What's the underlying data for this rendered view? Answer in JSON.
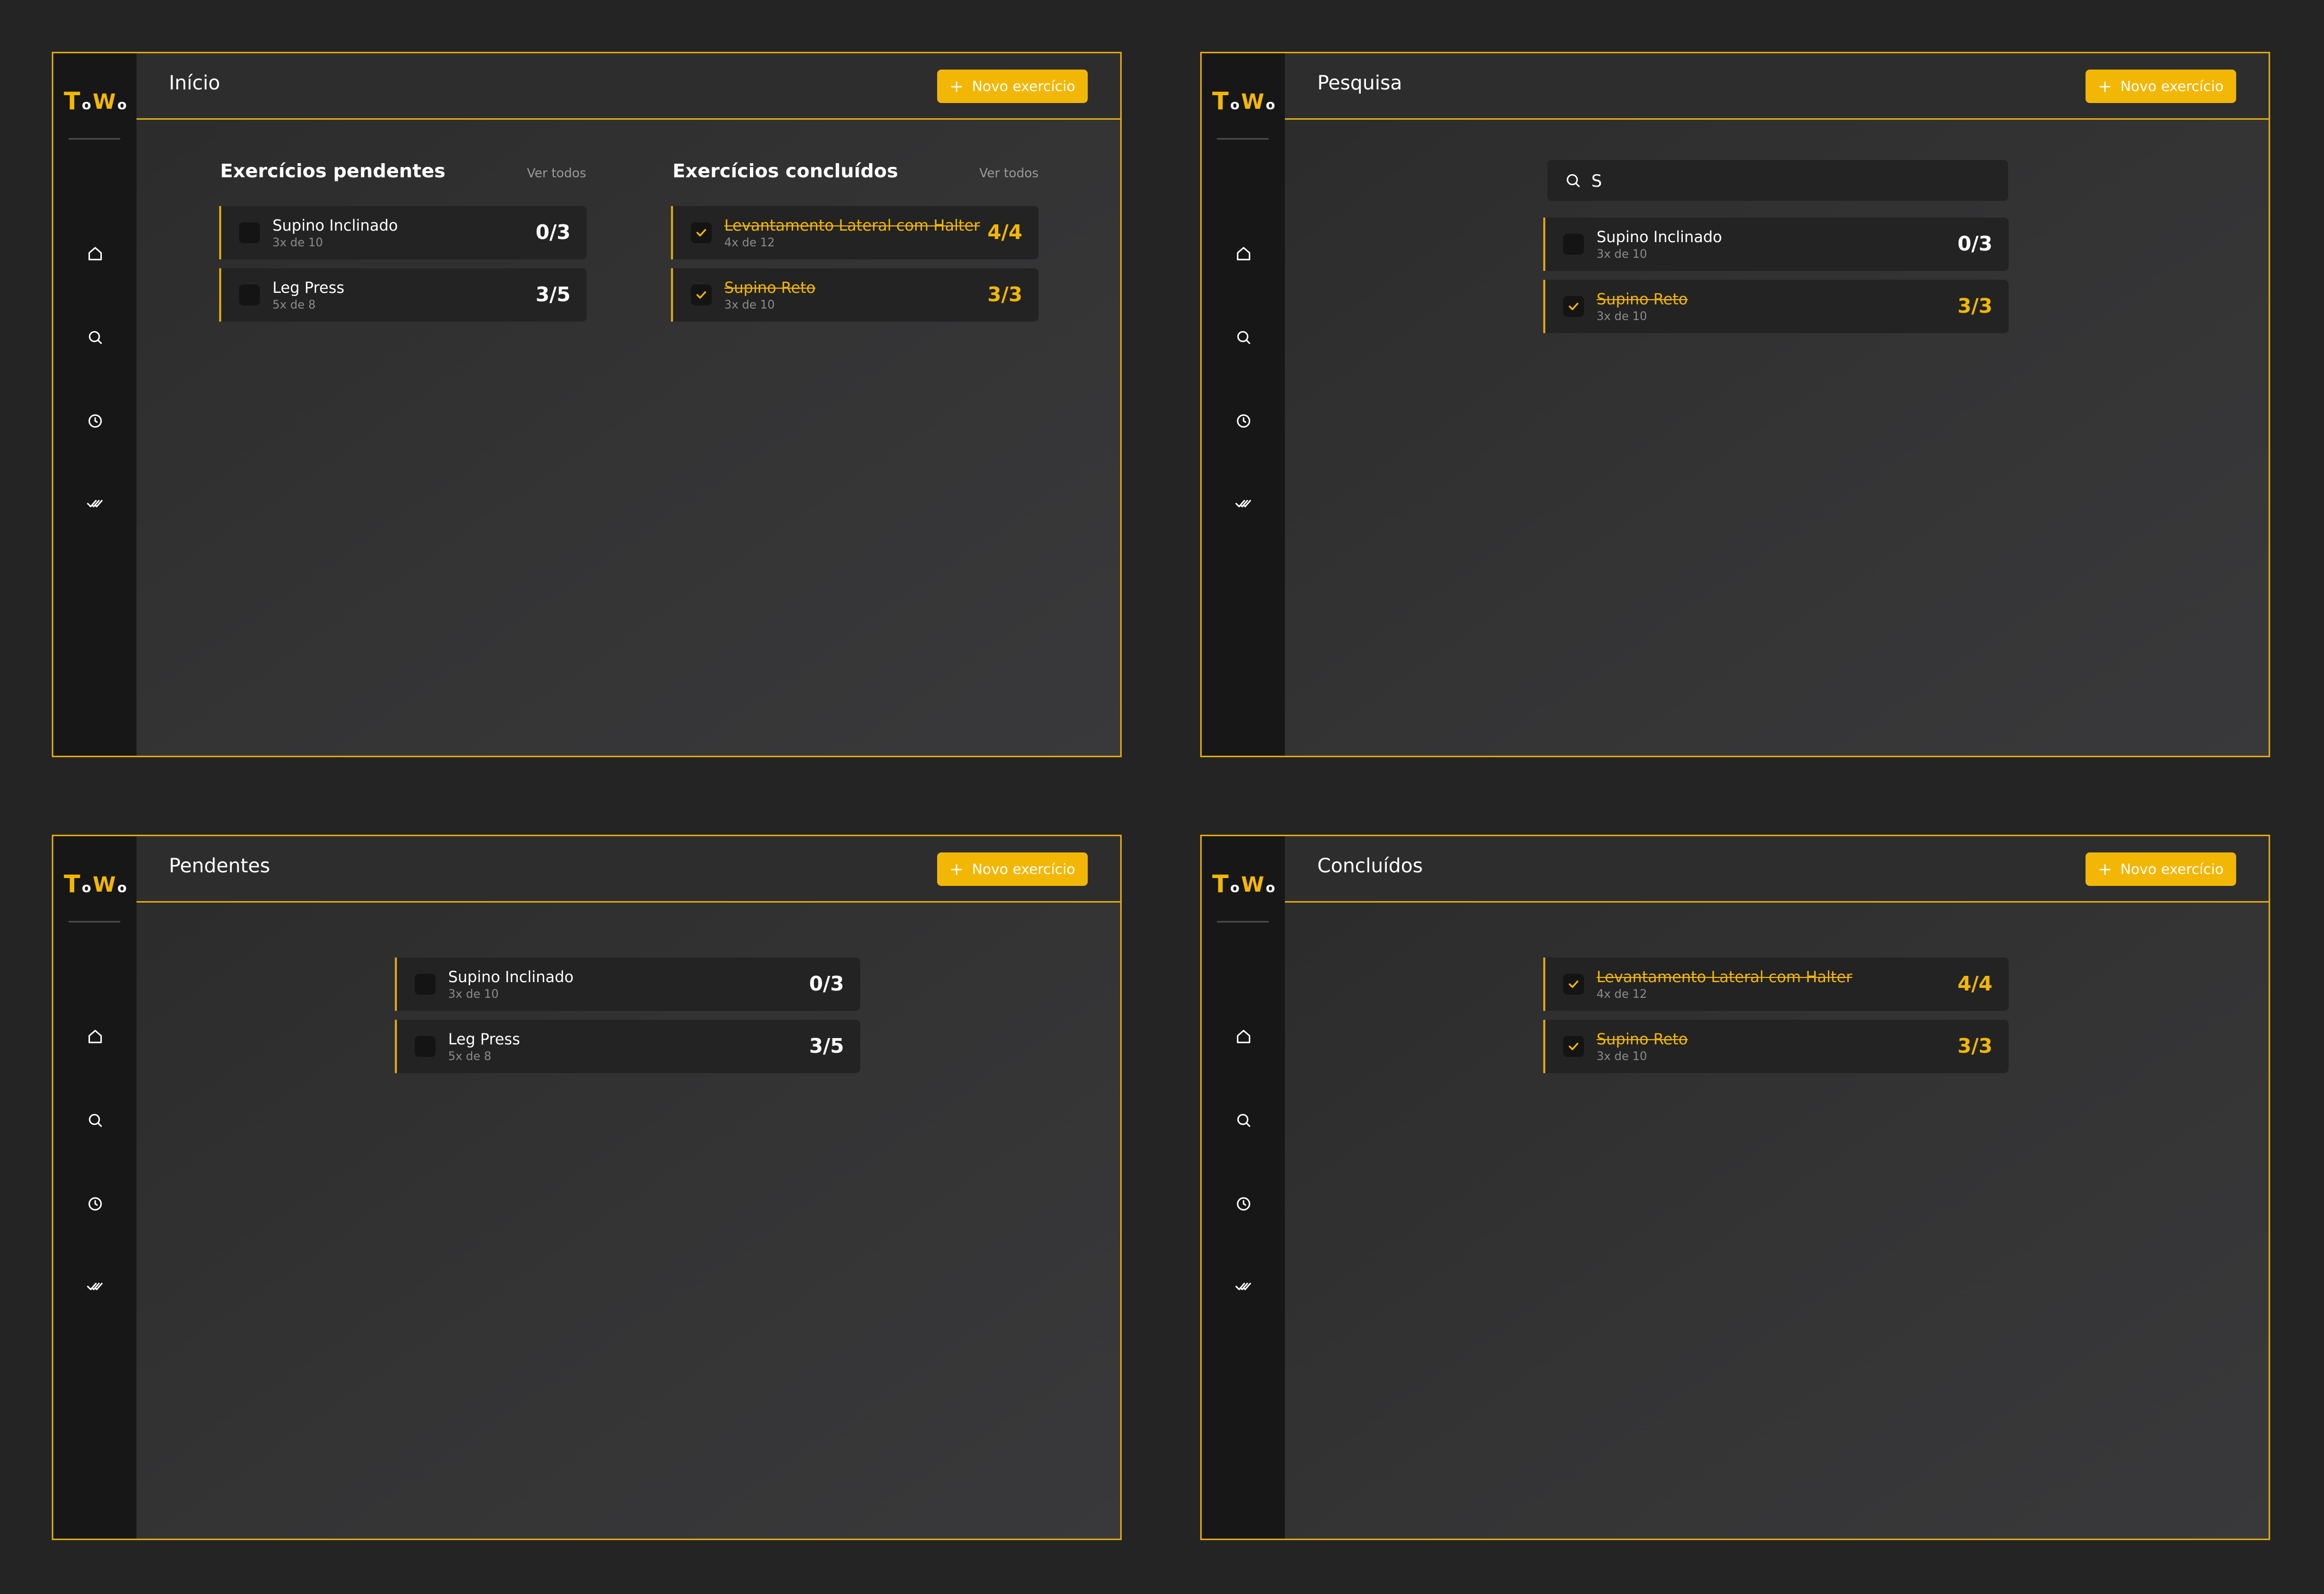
{
  "logo": {
    "t": "T",
    "o1": "o",
    "w": "W",
    "o2": "o"
  },
  "new_button_label": "Novo exercício",
  "new_button_plus": "+",
  "screens": {
    "home": {
      "title": "Início",
      "pending": {
        "title": "Exercícios pendentes",
        "see_all": "Ver todos",
        "items": [
          {
            "name": "Supino Inclinado",
            "sets": "3x de 10",
            "count": "0/3"
          },
          {
            "name": "Leg Press",
            "sets": "5x de 8",
            "count": "3/5"
          }
        ]
      },
      "done": {
        "title": "Exercícios concluídos",
        "see_all": "Ver todos",
        "items": [
          {
            "name": "Levantamento Lateral com Halter",
            "sets": "4x de 12",
            "count": "4/4"
          },
          {
            "name": "Supino Reto",
            "sets": "3x de 10",
            "count": "3/3"
          }
        ]
      }
    },
    "search": {
      "title": "Pesquisa",
      "query": "S",
      "results": [
        {
          "name": "Supino Inclinado",
          "sets": "3x de 10",
          "count": "0/3"
        },
        {
          "name": "Supino Reto",
          "sets": "3x de 10",
          "count": "3/3"
        }
      ]
    },
    "pending": {
      "title": "Pendentes",
      "items": [
        {
          "name": "Supino Inclinado",
          "sets": "3x de 10",
          "count": "0/3"
        },
        {
          "name": "Leg Press",
          "sets": "5x de 8",
          "count": "3/5"
        }
      ]
    },
    "done": {
      "title": "Concluídos",
      "items": [
        {
          "name": "Levantamento Lateral com Halter",
          "sets": "4x de 12",
          "count": "4/4"
        },
        {
          "name": "Supino Reto",
          "sets": "3x de 10",
          "count": "3/3"
        }
      ]
    }
  },
  "sidebar_icons": [
    "home-icon",
    "search-icon",
    "clock-icon",
    "double-check-icon"
  ],
  "colors": {
    "accent": "#f2b705",
    "background": "#242424",
    "sidebar": "#171717",
    "card": "#232323"
  }
}
